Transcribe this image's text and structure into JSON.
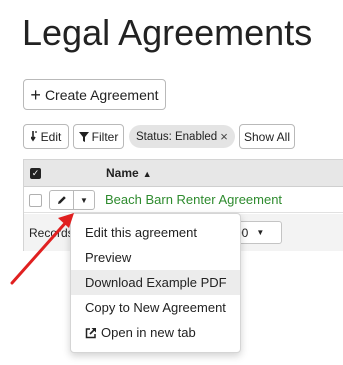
{
  "page": {
    "title": "Legal Agreements"
  },
  "toolbar": {
    "create_label": "Create Agreement",
    "edit_label": "Edit",
    "filter_label": "Filter",
    "status_filter": "Status: Enabled",
    "status_close": "×",
    "show_all_label": "Show All"
  },
  "table": {
    "columns": [
      "Name"
    ],
    "sort_indicator": "▲",
    "rows": [
      {
        "name": "Beach Barn Renter Agreement"
      }
    ],
    "footer_label": "Records",
    "per_page_value": "00"
  },
  "dropdown_menu": {
    "items": [
      {
        "label": "Edit this agreement"
      },
      {
        "label": "Preview"
      },
      {
        "label": "Download Example PDF",
        "highlighted": true
      },
      {
        "label": "Copy to New Agreement"
      },
      {
        "label": "Open in new tab",
        "icon": "external-link-icon"
      }
    ]
  },
  "annotation": {
    "arrow_color": "#e02020"
  },
  "colors": {
    "row_link": "#2e8b2e",
    "header_bg": "#e7e7e7",
    "pill_bg": "#e4e4e4",
    "menu_hover": "#ececec"
  },
  "icons": {
    "plus": "plus-icon",
    "edit": "edit-icon",
    "filter": "filter-icon",
    "pencil": "pencil-icon",
    "caret": "caret-down-icon",
    "external": "external-link-icon"
  }
}
